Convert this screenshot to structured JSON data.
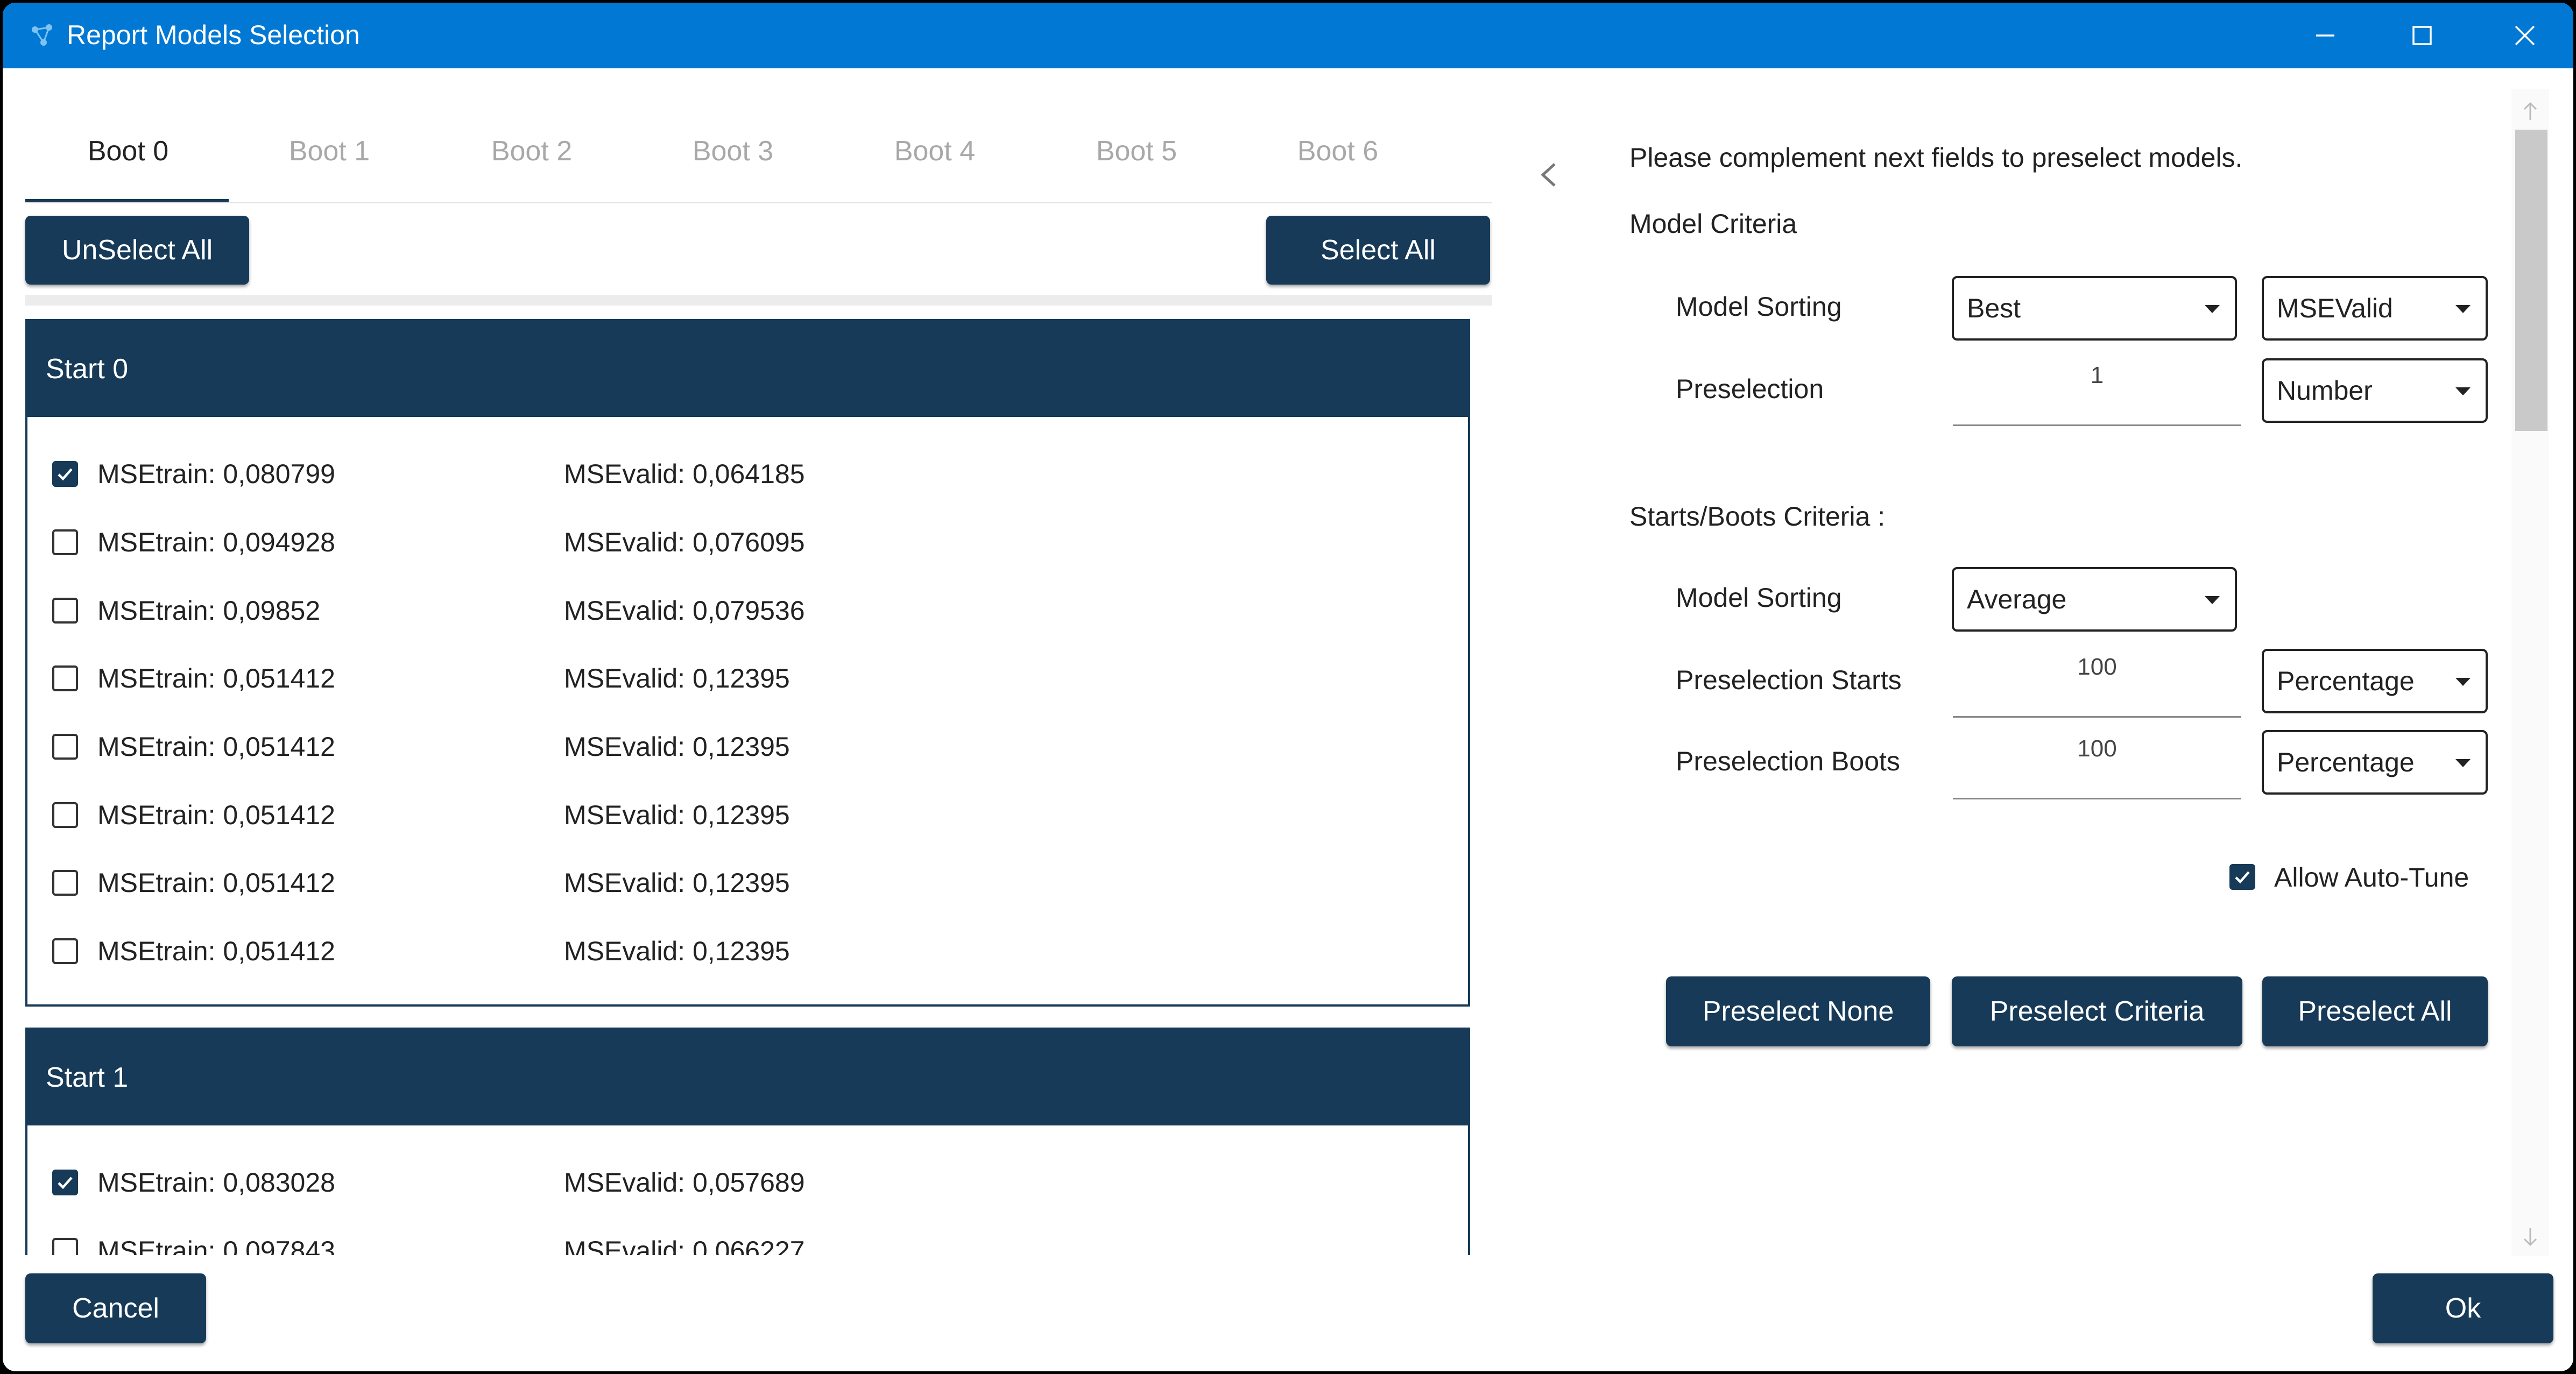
{
  "window": {
    "title": "Report Models Selection"
  },
  "tabs": [
    {
      "label": "Boot 0",
      "active": true
    },
    {
      "label": "Boot 1",
      "active": false
    },
    {
      "label": "Boot 2",
      "active": false
    },
    {
      "label": "Boot 3",
      "active": false
    },
    {
      "label": "Boot 4",
      "active": false
    },
    {
      "label": "Boot 5",
      "active": false
    },
    {
      "label": "Boot 6",
      "active": false
    }
  ],
  "left_toolbar": {
    "unselect_all": "UnSelect All",
    "select_all": "Select All"
  },
  "groups": [
    {
      "title": "Start 0",
      "rows": [
        {
          "checked": true,
          "train": "MSEtrain: 0,080799",
          "valid": "MSEvalid: 0,064185"
        },
        {
          "checked": false,
          "train": "MSEtrain: 0,094928",
          "valid": "MSEvalid: 0,076095"
        },
        {
          "checked": false,
          "train": "MSEtrain: 0,09852",
          "valid": "MSEvalid: 0,079536"
        },
        {
          "checked": false,
          "train": "MSEtrain: 0,051412",
          "valid": "MSEvalid: 0,12395"
        },
        {
          "checked": false,
          "train": "MSEtrain: 0,051412",
          "valid": "MSEvalid: 0,12395"
        },
        {
          "checked": false,
          "train": "MSEtrain: 0,051412",
          "valid": "MSEvalid: 0,12395"
        },
        {
          "checked": false,
          "train": "MSEtrain: 0,051412",
          "valid": "MSEvalid: 0,12395"
        },
        {
          "checked": false,
          "train": "MSEtrain: 0,051412",
          "valid": "MSEvalid: 0,12395"
        }
      ]
    },
    {
      "title": "Start 1",
      "rows": [
        {
          "checked": true,
          "train": "MSEtrain: 0,083028",
          "valid": "MSEvalid: 0,057689"
        },
        {
          "checked": false,
          "train": "MSEtrain: 0,097843",
          "valid": "MSEvalid: 0,066227"
        }
      ]
    }
  ],
  "right_panel": {
    "intro": "Please complement next fields to preselect models.",
    "model_criteria": {
      "heading": "Model Criteria",
      "sorting_label": "Model Sorting",
      "sorting_value": "Best",
      "sorting_metric": "MSEValid",
      "preselection_label": "Preselection",
      "preselection_value": "1",
      "preselection_unit": "Number"
    },
    "starts_boots": {
      "heading": "Starts/Boots Criteria :",
      "sorting_label": "Model Sorting",
      "sorting_value": "Average",
      "starts_label": "Preselection Starts",
      "starts_value": "100",
      "starts_unit": "Percentage",
      "boots_label": "Preselection Boots",
      "boots_value": "100",
      "boots_unit": "Percentage"
    },
    "allow_autotune": {
      "label": "Allow Auto-Tune",
      "checked": true
    },
    "buttons": {
      "none": "Preselect None",
      "criteria": "Preselect Criteria",
      "all": "Preselect All"
    }
  },
  "footer": {
    "cancel": "Cancel",
    "ok": "Ok"
  },
  "colors": {
    "titlebar": "#0078d4",
    "accent": "#163a57"
  }
}
